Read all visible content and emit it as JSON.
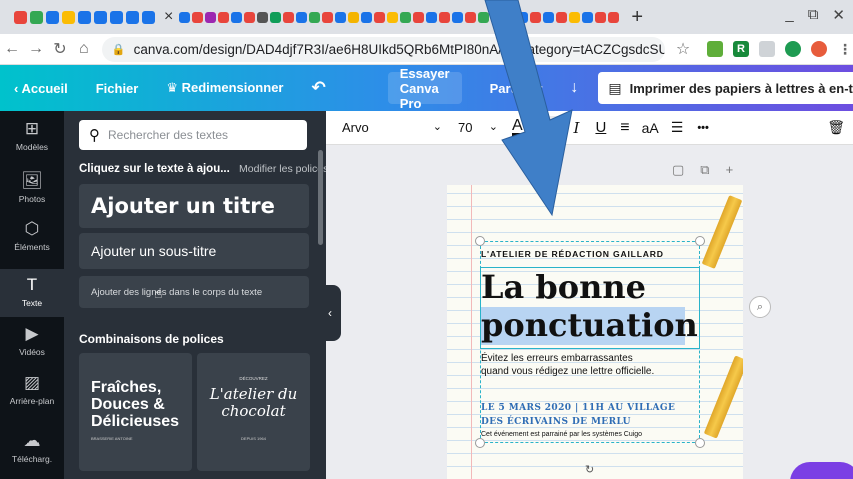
{
  "browser": {
    "url": "canva.com/design/DAD4djf7R3I/ae6H8UIkd5QRb6MtPI80nA/e...category=tACZCgsdcSU",
    "tab_close": "×",
    "new_tab": "+",
    "win_min": "_",
    "win_restore": "⧉",
    "win_close": "✕",
    "favicons": [
      "#e8453c",
      "#34a853",
      "#1a73e8",
      "#fbbc04",
      "#1a73e8",
      "#1a73e8",
      "#1a73e8",
      "#1a73e8",
      "#1a73e8"
    ],
    "favicons2": [
      "#1a73e8",
      "#e8453c",
      "#9c27b0",
      "#e8453c",
      "#1a73e8",
      "#e8453c",
      "#555",
      "#0f9d58",
      "#e8453c",
      "#1a73e8",
      "#34a853",
      "#e8453c",
      "#1a73e8",
      "#f4b400",
      "#1a73e8",
      "#e8453c",
      "#fbbc04",
      "#34a853",
      "#e8453c",
      "#1a73e8",
      "#e8453c",
      "#1a73e8",
      "#e8453c",
      "#34a853",
      "#fbbc04",
      "#e8453c",
      "#1a73e8",
      "#e8453c",
      "#1a73e8",
      "#e8453c",
      "#fbbc04",
      "#1a73e8",
      "#e8453c",
      "#e8453c"
    ],
    "ext_labels": [
      "",
      "R",
      "",
      "",
      ""
    ]
  },
  "topbar": {
    "home": "Accueil",
    "file": "Fichier",
    "resize": "Redimensionner",
    "undo": "↶",
    "try_pro": "Essayer Canva Pro",
    "share": "Partager",
    "download": "↓",
    "print_label": "Imprimer des papiers à lettres à en-tête",
    "chevron": "⌄"
  },
  "rail": [
    {
      "label": "Modèles",
      "icon": "⊞"
    },
    {
      "label": "Photos",
      "icon": "🖼"
    },
    {
      "label": "Éléments",
      "icon": "⬡"
    },
    {
      "label": "Texte",
      "icon": "T"
    },
    {
      "label": "Vidéos",
      "icon": "▶"
    },
    {
      "label": "Arrière-plan",
      "icon": "▨"
    },
    {
      "label": "Télécharg.",
      "icon": "☁"
    }
  ],
  "panel": {
    "search_placeholder": "Rechercher des textes",
    "hint": "Cliquez sur le texte à ajou...",
    "modify_fonts": "Modifier les polices",
    "add_title": "Ajouter un titre",
    "add_subtitle": "Ajouter un sous-titre",
    "add_body": "Ajouter des lignes dans le corps du texte",
    "combos_title": "Combinaisons de polices",
    "combo1": "Fraîches, Douces & Délicieuses",
    "combo1_lines": [
      "Fraîches,",
      "Douces &",
      "Délicieuses"
    ],
    "combo1_sub": "BRASSERIE ANTOINE",
    "combo2_top": "DÉCOUVREZ",
    "combo2_lines": [
      "L'atelier du",
      "chocolat"
    ],
    "combo2_sub": "DEPUIS 1964",
    "collapse": "‹"
  },
  "toolbar": {
    "font": "Arvo",
    "size": "70",
    "color": "A",
    "bold": "B",
    "italic": "I",
    "underline": "U",
    "align": "≡",
    "case": "aA",
    "list": "☰",
    "more": "•••",
    "trash": "🗑"
  },
  "page": {
    "header": "L'ATELIER DE RÉDACTION GAILLARD",
    "title_1": "La bonne",
    "title_2": "ponctuation",
    "body_1": "Évitez les erreurs embarrassantes",
    "body_2": "quand vous rédigez une lettre officielle.",
    "event_1": "LE 5 MARS 2020 | 11H AU VILLAGE",
    "event_2": "DES ÉCRIVAINS DE MERLU",
    "sponsor": "Cet événement est parrainé par les systèmes Cuigo",
    "page_tools": [
      "▢",
      "⧉",
      "+"
    ],
    "rotate": "↻"
  },
  "colors": {
    "accent_teal": "#29b3c9",
    "arrow_blue": "#3f7fc8",
    "panel_bg": "#293039",
    "rail_bg": "#0e1318"
  }
}
